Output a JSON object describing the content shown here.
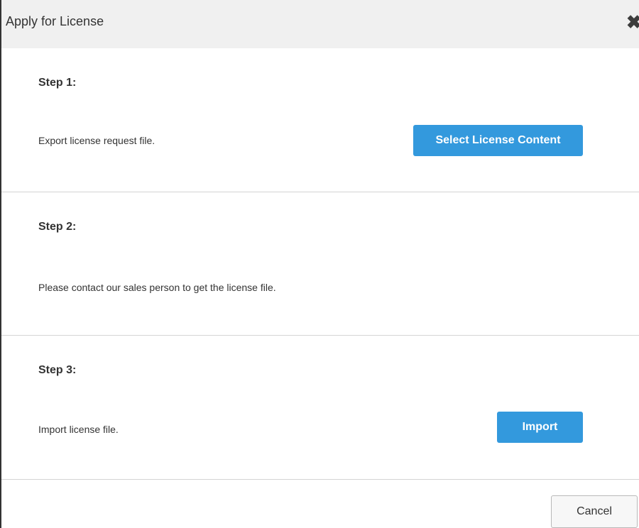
{
  "dialog": {
    "title": "Apply for License",
    "close_icon": "close-icon"
  },
  "steps": [
    {
      "title": "Step 1:",
      "text": "Export license request file.",
      "button_label": "Select License Content"
    },
    {
      "title": "Step 2:",
      "text": "Please contact our sales person to get the license file."
    },
    {
      "title": "Step 3:",
      "text": "Import license file.",
      "button_label": "Import"
    }
  ],
  "footer": {
    "cancel_label": "Cancel"
  },
  "colors": {
    "primary_button": "#3399dd",
    "titlebar_bg": "#f0f0f0",
    "divider": "#d4d4d4"
  }
}
